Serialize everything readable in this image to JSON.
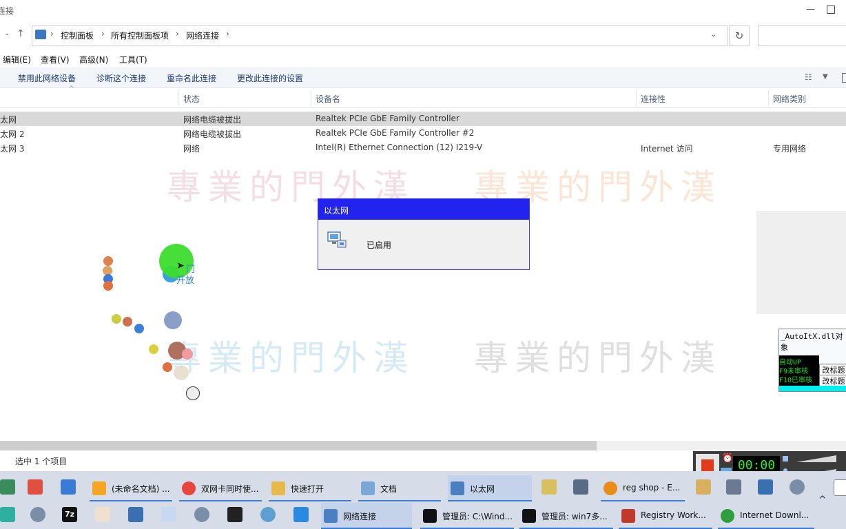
{
  "window": {
    "title": "连接"
  },
  "breadcrumb": [
    "控制面板",
    "所有控制面板项",
    "网络连接"
  ],
  "menu": [
    "编辑(E)",
    "查看(V)",
    "高级(N)",
    "工具(T)"
  ],
  "commands": [
    "禁用此网络设备",
    "诊断这个连接",
    "重命名此连接",
    "更改此连接的设置"
  ],
  "columns": [
    "状态",
    "设备名",
    "连接性",
    "网络类别"
  ],
  "rows": [
    {
      "name": "太网",
      "status": "网络电缆被拔出",
      "device": "Realtek PCIe GbE Family Controller",
      "connectivity": "",
      "category": "",
      "selected": true
    },
    {
      "name": "太网 2",
      "status": "网络电缆被拔出",
      "device": "Realtek PCIe GbE Family Controller #2",
      "connectivity": "",
      "category": "",
      "selected": false
    },
    {
      "name": "太网 3",
      "status": "网络",
      "device": "Intel(R) Ethernet Connection (12) I219-V",
      "connectivity": "Internet 访问",
      "category": "专用网络",
      "selected": false
    }
  ],
  "watermark": "專業的門外漢",
  "cursor_bubble": {
    "line1": "门",
    "line2": "开放"
  },
  "popup": {
    "title": "以太网",
    "status": "已启用"
  },
  "autoit": {
    "title": "_AutoItX.dll对象",
    "lines": [
      "自动UP",
      "F9未审核",
      "F10已审核"
    ],
    "btn1": "改标题",
    "btn2": "改标题"
  },
  "statusbar": {
    "selection": "选中 1 个项目"
  },
  "recorder": {
    "timer": "00:00"
  },
  "taskbar": {
    "row1": [
      {
        "label": "(未命名文档) ...",
        "color": "#f5a623"
      },
      {
        "label": "双网卡同时使...",
        "color": "#e8453c"
      },
      {
        "label": "快速打开",
        "color": "#e8b84a"
      },
      {
        "label": "文档",
        "color": "#7aa7d8"
      },
      {
        "label": "以太网",
        "color": "#4a7fc1"
      },
      {
        "label": "reg shop - E...",
        "color": "#e88c1a"
      }
    ],
    "row2": [
      {
        "label": "网络连接",
        "color": "#4a7fc1"
      },
      {
        "label": "管理员: C:\\Wind...",
        "color": "#111111"
      },
      {
        "label": "管理员: win7多...",
        "color": "#111111"
      },
      {
        "label": "Registry Work...",
        "color": "#c0392b"
      },
      {
        "label": "Internet Downl...",
        "color": "#2e9e3f"
      }
    ],
    "icons_row2": [
      "7z"
    ]
  }
}
